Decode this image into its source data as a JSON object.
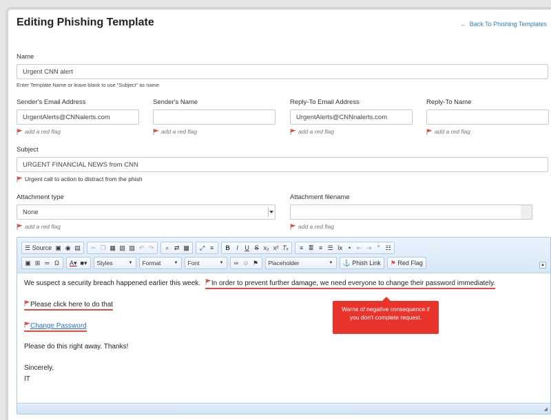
{
  "page": {
    "title": "Editing Phishing Template",
    "back_label": "Back To Phishing Templates"
  },
  "form": {
    "name": {
      "label": "Name",
      "value": "Urgent CNN alert",
      "hint": "Enter Template Name or leave blank to use \"Subject\" as name"
    },
    "sender_email": {
      "label": "Sender's Email Address",
      "value": "UrgentAlerts@CNNalerts.com",
      "flag": "add a red flag"
    },
    "sender_name": {
      "label": "Sender's Name",
      "value": "",
      "flag": "add a red flag"
    },
    "reply_to_email": {
      "label": "Reply-To Email Address",
      "value": "UrgentAlerts@CNNnalerts.com",
      "flag": "add a red flag"
    },
    "reply_to_name": {
      "label": "Reply-To Name",
      "value": "",
      "flag": "add a red flag"
    },
    "subject": {
      "label": "Subject",
      "value": "URGENT FINANCIAL NEWS from CNN",
      "flag": "Urgent call to action to distract from the phish"
    },
    "attachment_type": {
      "label": "Attachment type",
      "value": "None",
      "flag": "add a red flag"
    },
    "attachment_filename": {
      "label": "Attachment filename",
      "value": "",
      "flag": "add a red flag"
    }
  },
  "toolbar": {
    "source": "Source",
    "styles": "Styles",
    "format": "Format",
    "font": "Font",
    "placeholder": "Placeholder",
    "phish_link": "Phish Link",
    "red_flag": "Red Flag"
  },
  "email": {
    "line1_plain": "We suspect a security breach happened earlier this week.",
    "line1_flagged": "In order to prevent further damage, we need everyone to change their password immediately.",
    "line2": "Please click here to do that",
    "line3": "Change Password",
    "line4": "Please do this right away. Thanks!",
    "line5": "Sincerely,",
    "line6": "IT",
    "tooltip": "Warns of negative consequence if you don't complete request."
  },
  "colors": {
    "flag": "#e24a3b",
    "link": "#2a7fc4",
    "tooltip_bg": "#e8342b"
  }
}
